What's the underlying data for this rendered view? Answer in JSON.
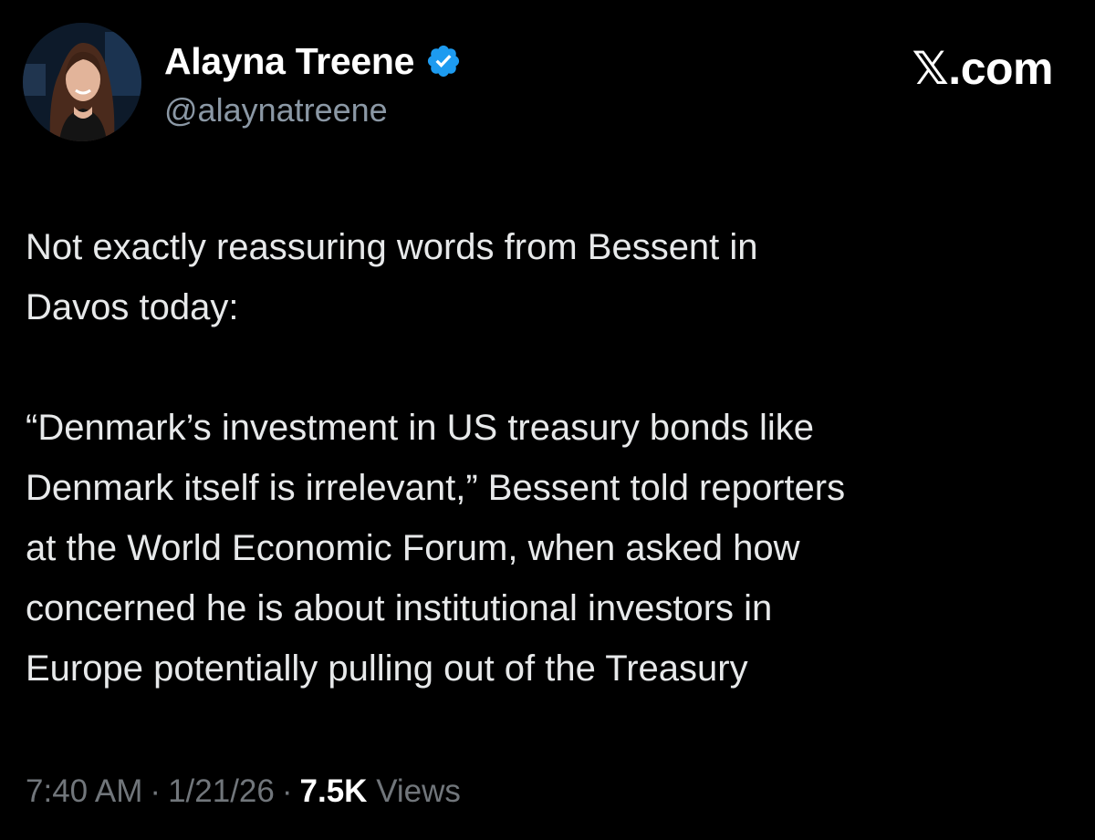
{
  "author": {
    "display_name": "Alayna Treene",
    "handle": "@alaynatreene",
    "verified_icon": "verified-badge-icon",
    "avatar_icon": "profile-photo"
  },
  "brand": {
    "label": "𝕏.com"
  },
  "tweet": {
    "paragraph_1": "Not exactly reassuring words from Bessent in\nDavos today:",
    "paragraph_2": "“Denmark’s investment in US treasury bonds like\nDenmark itself is irrelevant,” Bessent told reporters\nat the World Economic Forum, when asked how\nconcerned he is about institutional investors in\nEurope potentially pulling out of the Treasury"
  },
  "meta": {
    "time": "7:40 AM",
    "separator": "·",
    "date": "1/21/26",
    "views_count": "7.5K",
    "views_label": "Views"
  },
  "colors": {
    "background": "#000000",
    "text": "#e7e9ea",
    "secondary_text": "#8b98a5",
    "verified_blue": "#1d9bf0"
  }
}
